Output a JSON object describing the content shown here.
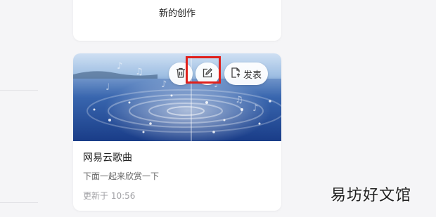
{
  "new_card": {
    "label": "新的创作"
  },
  "work_card": {
    "title": "网易云歌曲",
    "description": "下面一起来欣赏一下",
    "updated": "更新于 10:56",
    "actions": {
      "publish_label": "发表"
    }
  },
  "watermark": "易坊好文馆",
  "colors": {
    "highlight": "#e0201b",
    "background": "#f5f5f7",
    "card": "#ffffff"
  },
  "icons": [
    "trash-icon",
    "edit-icon",
    "publish-icon"
  ]
}
